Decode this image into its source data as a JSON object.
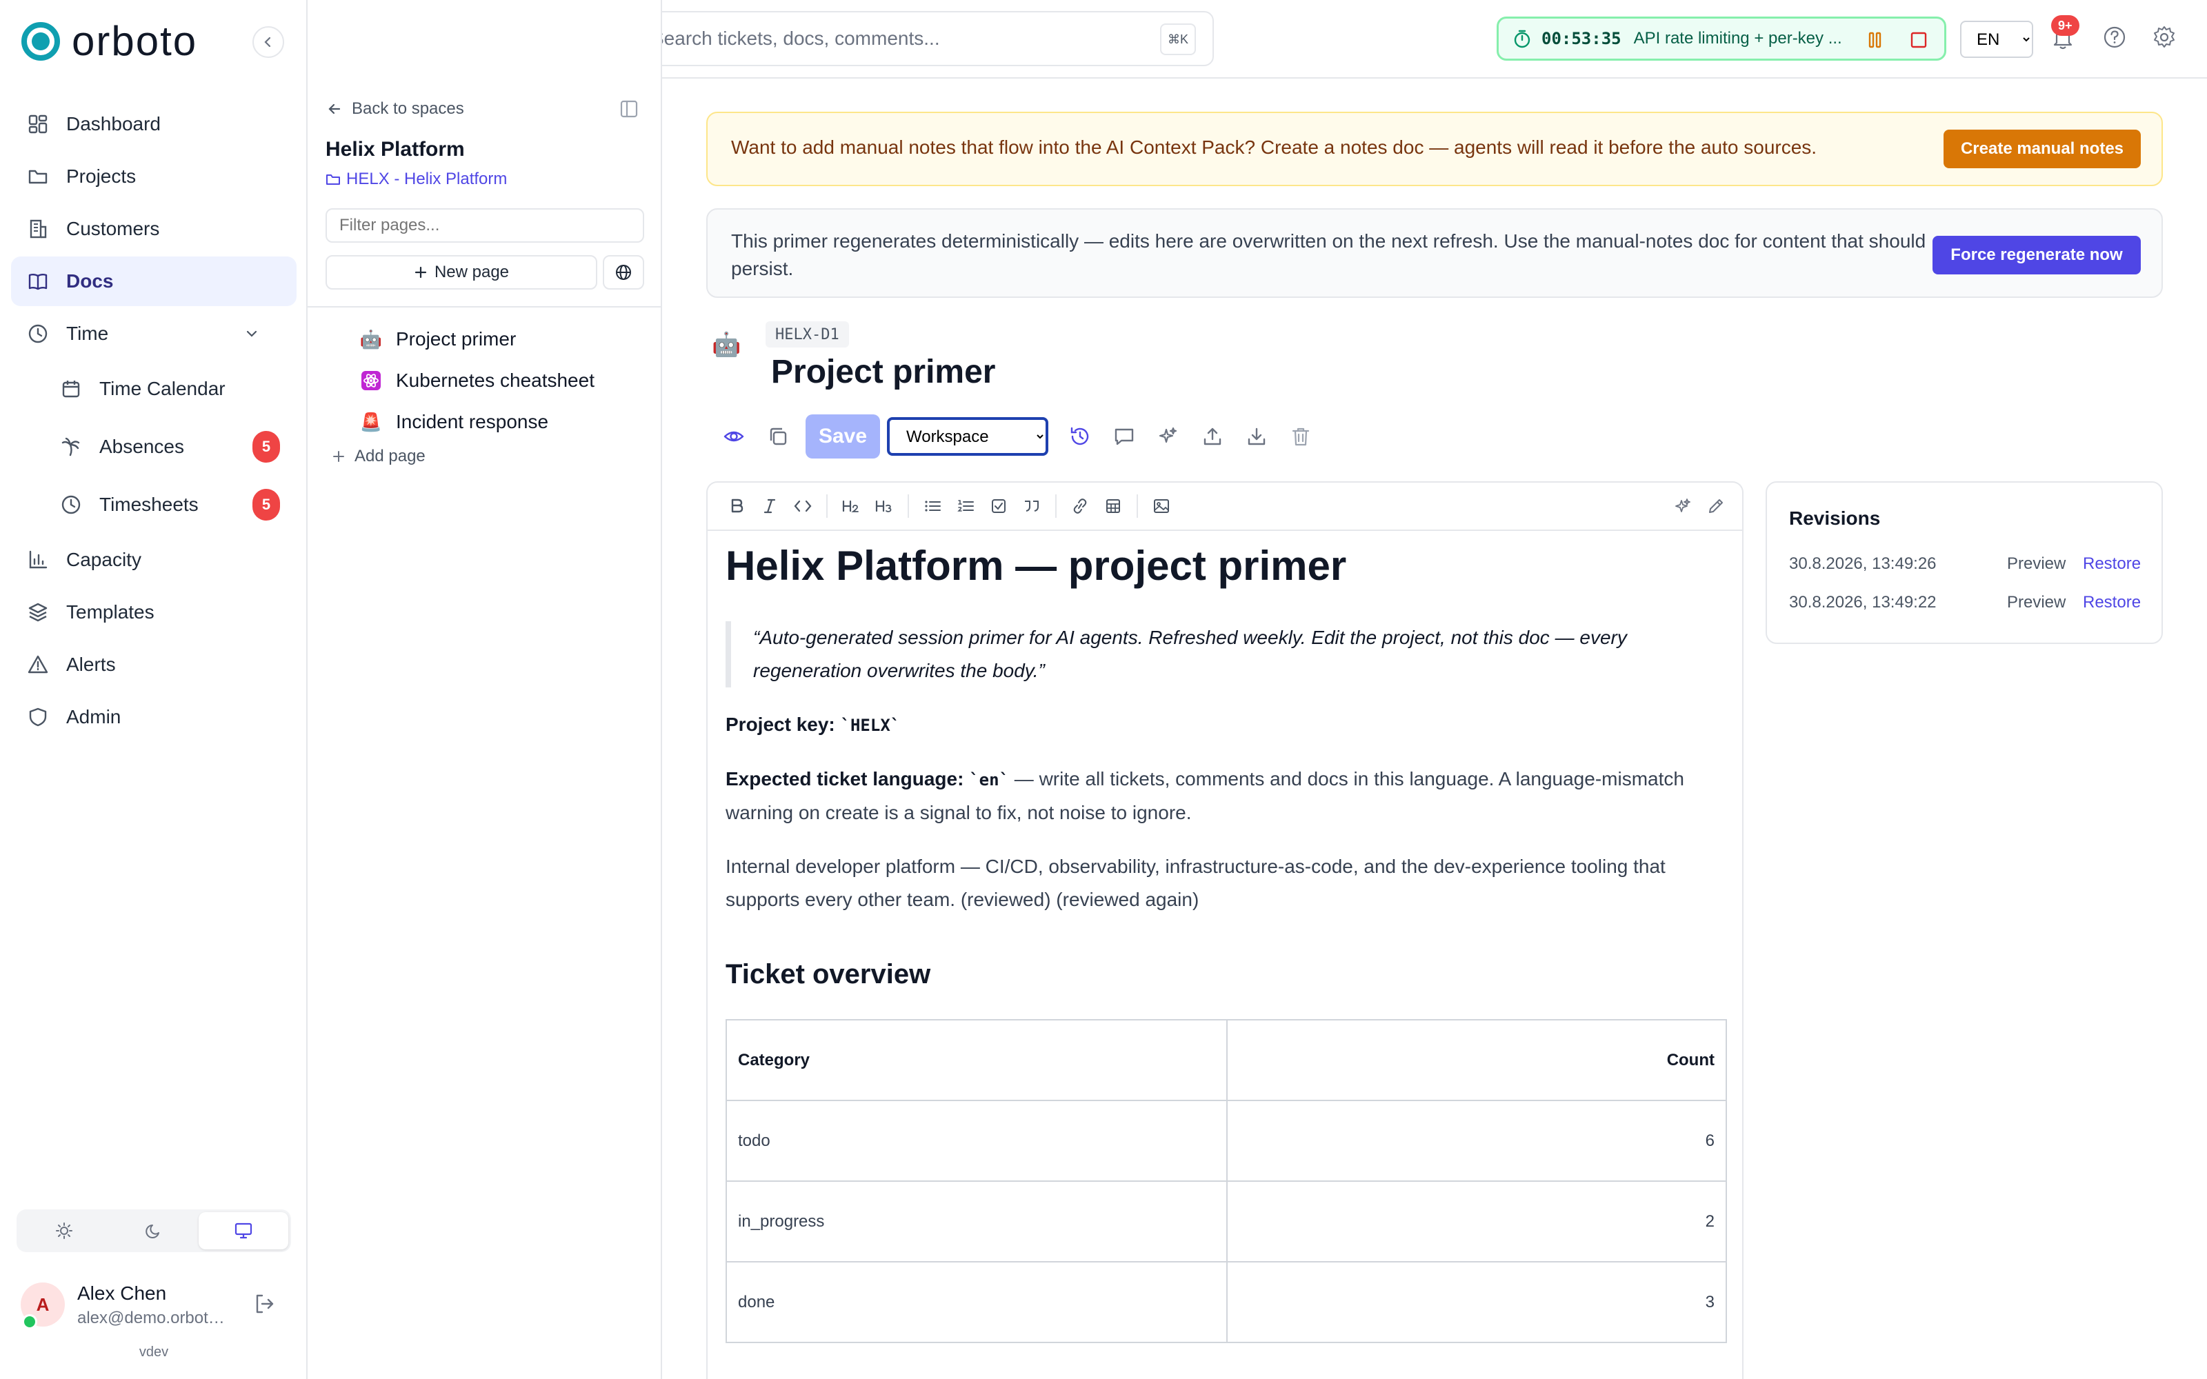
{
  "brand": {
    "name": "orboto",
    "accent": "#0f9fb0"
  },
  "sidebar": {
    "items": [
      {
        "label": "Dashboard",
        "icon": "dashboard-icon"
      },
      {
        "label": "Projects",
        "icon": "folder-icon"
      },
      {
        "label": "Customers",
        "icon": "building-icon"
      },
      {
        "label": "Docs",
        "icon": "book-icon",
        "active": true
      },
      {
        "label": "Time",
        "icon": "clock-icon",
        "expanded": true
      },
      {
        "label": "Time Calendar",
        "icon": "calendar-icon"
      },
      {
        "label": "Absences",
        "icon": "palm-tree-icon",
        "badge": "5"
      },
      {
        "label": "Timesheets",
        "icon": "clock-icon",
        "badge": "5"
      },
      {
        "label": "Capacity",
        "icon": "bar-chart-icon"
      },
      {
        "label": "Templates",
        "icon": "layers-icon"
      },
      {
        "label": "Alerts",
        "icon": "warning-icon"
      },
      {
        "label": "Admin",
        "icon": "shield-icon"
      }
    ],
    "theme_modes": [
      "light",
      "dark",
      "system"
    ],
    "theme_selected": "system",
    "user": {
      "initial": "A",
      "name": "Alex Chen",
      "email": "alex@demo.orbot…"
    },
    "version": "vdev"
  },
  "tree": {
    "back_label": "Back to spaces",
    "space_title": "Helix Platform",
    "space_sub": "HELX - Helix Platform",
    "filter_placeholder": "Filter pages...",
    "new_page_label": "New page",
    "pages": [
      {
        "emoji": "🤖",
        "label": "Project primer"
      },
      {
        "emoji": "⚛",
        "label": "Kubernetes cheatsheet"
      },
      {
        "emoji": "🚨",
        "label": "Incident response"
      }
    ],
    "add_page_label": "Add page"
  },
  "topbar": {
    "search_placeholder": "Search tickets, docs, comments...",
    "search_shortcut": "⌘K",
    "timer_time": "00:53:35",
    "timer_task": "API rate limiting + per-key ...",
    "language": "EN",
    "notifications_badge": "9+"
  },
  "banners": {
    "manual_notes_text": "Want to add manual notes that flow into the AI Context Pack? Create a notes doc — agents will read it before the auto sources.",
    "manual_notes_button": "Create manual notes",
    "regen_text": "This primer regenerates deterministically — edits here are overwritten on the next refresh. Use the manual-notes doc for content that should persist.",
    "regen_button": "Force regenerate now"
  },
  "doc": {
    "emoji": "🤖",
    "key": "HELX-D1",
    "title": "Project primer",
    "save_label": "Save",
    "visibility": "Workspace",
    "h1": "Helix Platform — project primer",
    "quote": "“Auto-generated session primer for AI agents. Refreshed weekly. Edit the project, not this doc — every regeneration overwrites the body.”",
    "project_key_label": "Project key:",
    "project_key_value": "`HELX`",
    "lang_label": "Expected ticket language:",
    "lang_value": "`en`",
    "lang_text": "— write all tickets, comments and docs in this language. A language-mismatch warning on create is a signal to fix, not noise to ignore.",
    "description": "Internal developer platform — CI/CD, observability, infrastructure-as-code, and the dev-experience tooling that supports every other team. (reviewed) (reviewed again)",
    "h2": "Ticket overview",
    "table": {
      "headers": [
        "Category",
        "Count"
      ],
      "rows": [
        {
          "category": "todo",
          "count": "6"
        },
        {
          "category": "in_progress",
          "count": "2"
        },
        {
          "category": "done",
          "count": "3"
        }
      ]
    }
  },
  "revisions": {
    "title": "Revisions",
    "items": [
      {
        "timestamp": "30.8.2026, 13:49:26",
        "preview": "Preview",
        "restore": "Restore"
      },
      {
        "timestamp": "30.8.2026, 13:49:22",
        "preview": "Preview",
        "restore": "Restore"
      }
    ]
  }
}
